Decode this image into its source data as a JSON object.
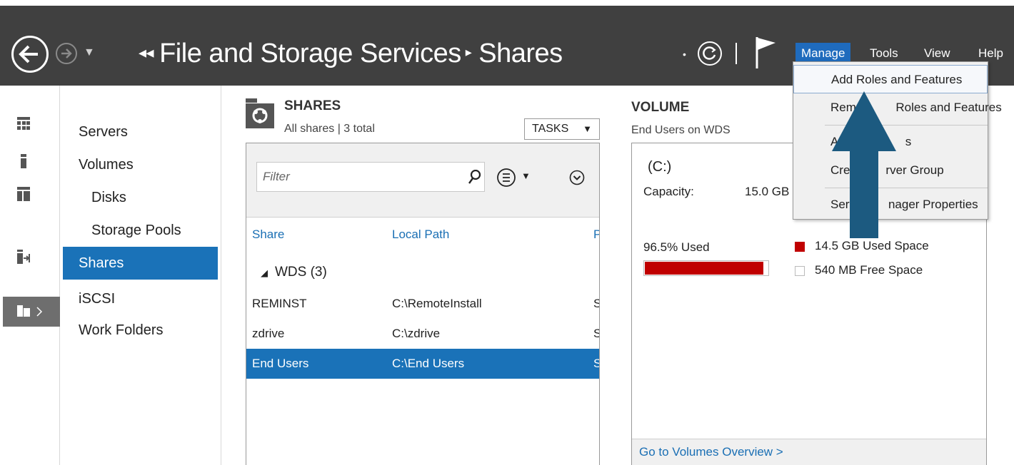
{
  "toolbar": {
    "breadcrumb_parent": "File and Storage Services",
    "breadcrumb_current": "Shares",
    "menus": [
      "Manage",
      "Tools",
      "View",
      "Help"
    ],
    "active_menu": "Manage"
  },
  "manage_menu": {
    "items": [
      "Add Roles and Features",
      "Remove Roles and Features",
      "Add Servers",
      "Create Server Group",
      "Server Manager Properties"
    ],
    "visible_text": [
      "Add Roles and Features",
      "Remo",
      "Roles and Features",
      "Ad",
      "s",
      "Cre",
      "rver Group",
      "Serv",
      "nager Properties"
    ]
  },
  "sidebar": {
    "items": [
      {
        "label": "Servers",
        "indent": false
      },
      {
        "label": "Volumes",
        "indent": false
      },
      {
        "label": "Disks",
        "indent": true
      },
      {
        "label": "Storage Pools",
        "indent": true
      },
      {
        "label": "Shares",
        "indent": false,
        "selected": true
      },
      {
        "label": "iSCSI",
        "indent": false
      },
      {
        "label": "Work Folders",
        "indent": false
      }
    ]
  },
  "shares": {
    "title": "SHARES",
    "subtitle": "All shares | 3 total",
    "tasks_label": "TASKS",
    "filter_placeholder": "Filter",
    "columns": [
      "Share",
      "Local Path",
      "P"
    ],
    "group_label": "WDS (3)",
    "rows": [
      {
        "share": "REMINST",
        "path": "C:\\RemoteInstall",
        "p": "S"
      },
      {
        "share": "zdrive",
        "path": "C:\\zdrive",
        "p": "S"
      },
      {
        "share": "End Users",
        "path": "C:\\End Users",
        "p": "S",
        "selected": true
      }
    ]
  },
  "volume": {
    "title": "VOLUME",
    "subtitle": "End Users on WDS",
    "drive": "(C:)",
    "capacity_label": "Capacity:",
    "capacity_value": "15.0 GB",
    "used_text": "96.5% Used",
    "used_fraction": 0.965,
    "legend_used": "14.5 GB Used Space",
    "legend_free": "540 MB Free Space",
    "link": "Go to Volumes Overview >"
  },
  "colors": {
    "toolbar_bg": "#404040",
    "selection_blue": "#1a72b8",
    "menu_active": "#1f6bbd",
    "used_red": "#c00000",
    "arrow": "#1c5a80"
  }
}
